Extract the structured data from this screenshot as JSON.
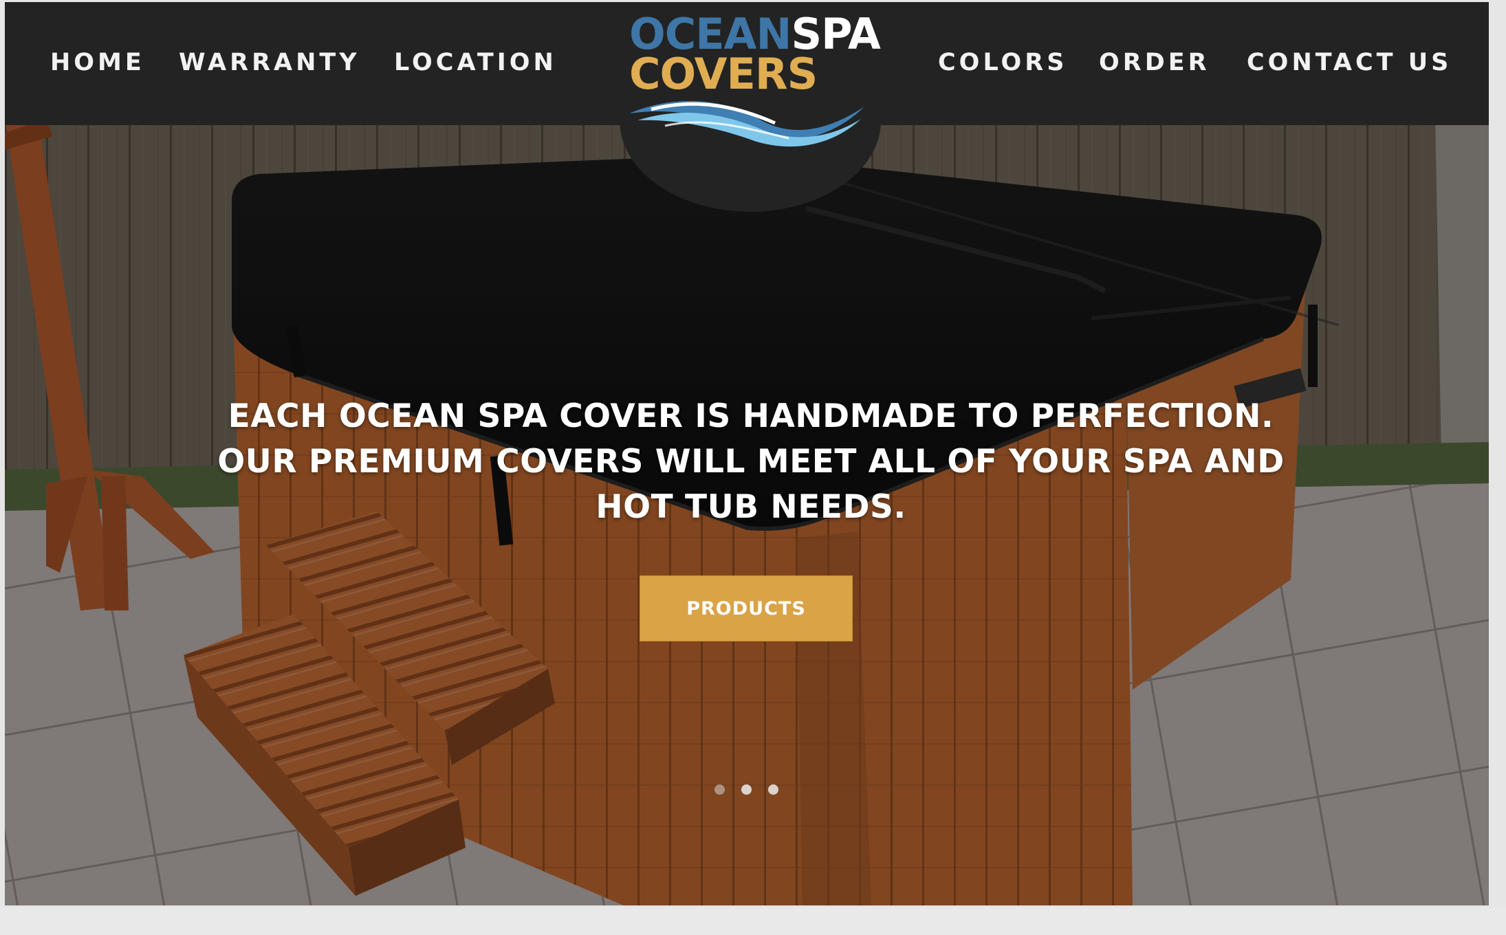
{
  "nav": {
    "left": [
      {
        "label": "HOME"
      },
      {
        "label": "WARRANTY"
      },
      {
        "label": "LOCATION"
      }
    ],
    "right": [
      {
        "label": "COLORS"
      },
      {
        "label": "ORDER"
      },
      {
        "label": "CONTACT US"
      }
    ]
  },
  "logo": {
    "word1": "OCEAN",
    "word2": "SPA",
    "word3": "COVERS"
  },
  "hero": {
    "line1": "EACH OCEAN SPA COVER IS HANDMADE TO PERFECTION.",
    "line2": "OUR PREMIUM COVERS WILL MEET ALL OF YOUR SPA AND",
    "line3": "HOT TUB NEEDS.",
    "button_label": "PRODUCTS",
    "slides": 3,
    "active_slide": 1
  },
  "colors": {
    "navbar": "#232323",
    "accent_gold": "#d9a346",
    "logo_blue": "#3d76a7",
    "logo_gold": "#e0ad52"
  },
  "icons": {
    "logo_mark": "wave-icon"
  }
}
